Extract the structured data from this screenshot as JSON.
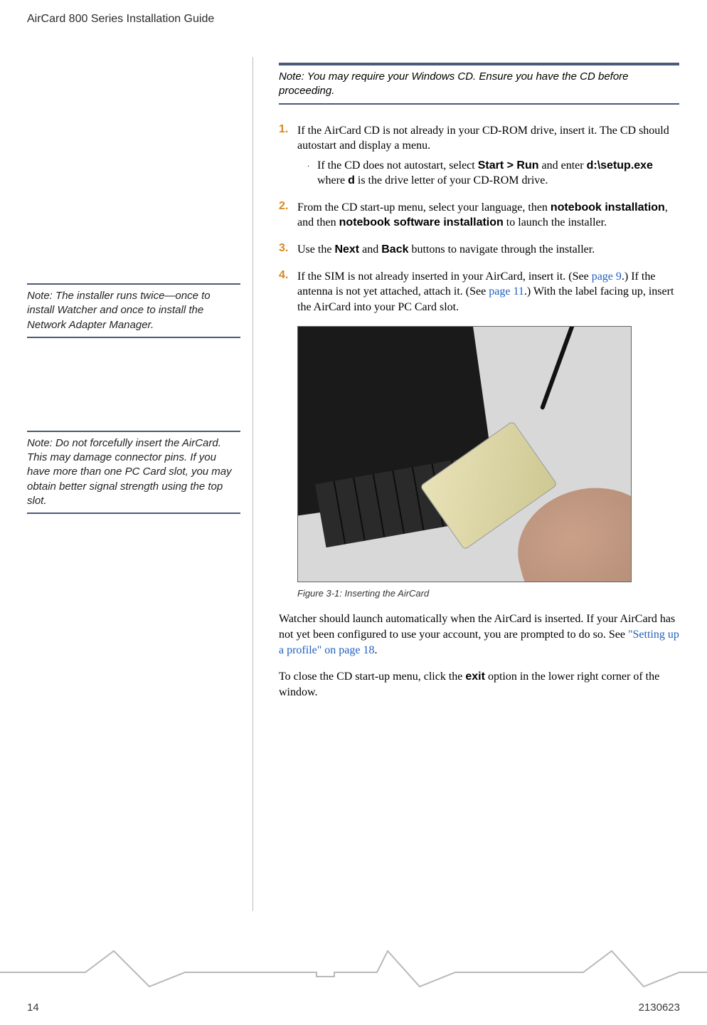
{
  "header": {
    "title": "AirCard 800 Series Installation Guide"
  },
  "top_note": {
    "label": "Note:",
    "text": "You may require your Windows CD. Ensure you have the CD before proceeding."
  },
  "steps": {
    "s1": {
      "num": "1.",
      "body": "If the AirCard CD is not already in your CD-ROM drive, insert it. The CD should autostart and display a menu.",
      "sub_pre": "If the CD does not autostart, select ",
      "sub_cmd1": "Start > Run",
      "sub_mid1": " and enter ",
      "sub_cmd2": "d:\\setup.exe",
      "sub_mid2": " where ",
      "sub_cmd3": "d",
      "sub_post": " is the drive letter of your CD-ROM drive."
    },
    "s2": {
      "num": "2.",
      "pre": "From the CD start-up menu, select your language, then ",
      "b1": "notebook installation",
      "mid": ", and then ",
      "b2": "notebook software installation",
      "post": " to launch the installer."
    },
    "s3": {
      "num": "3.",
      "pre": "Use the ",
      "b1": "Next",
      "mid": " and ",
      "b2": "Back",
      "post": " buttons to navigate through the installer."
    },
    "s4": {
      "num": "4.",
      "p1": "If the SIM is not already inserted in your AirCard, insert it. (See ",
      "l1": "page 9",
      "p2": ".) If the antenna is not yet attached, attach it. (See ",
      "l2": "page 11",
      "p3": ".) With the label facing up, insert the AirCard into your PC Card slot."
    }
  },
  "side_notes": {
    "n1": {
      "label": "Note:",
      "text": "The installer runs twice—once to install Watcher and once to install the Network Adapter Manager."
    },
    "n2": {
      "label": "Note:",
      "text": "Do not forcefully insert the AirCard. This may damage connector pins. If you have more than one PC Card slot, you may obtain better signal strength using the top slot."
    }
  },
  "figure": {
    "caption": "Figure 3-1:  Inserting the AirCard"
  },
  "para1": {
    "p1": "Watcher should launch automatically when the AirCard is inserted. If your AirCard has not yet been configured to use your account, you are prompted to do so. See ",
    "link": "\"Setting up a profile\" on page 18",
    "p2": "."
  },
  "para2": {
    "p1": "To close the CD start-up menu, click the ",
    "b": "exit",
    "p2": " option in the lower right corner of the window."
  },
  "footer": {
    "page": "14",
    "docnum": "2130623"
  }
}
